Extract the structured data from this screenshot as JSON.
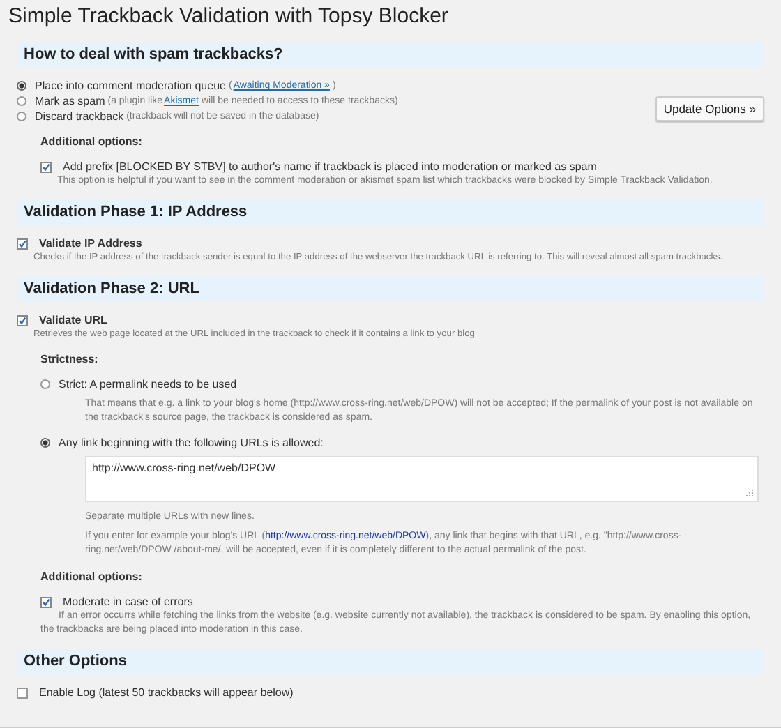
{
  "title": "Simple Trackback Validation with Topsy Blocker",
  "spam": {
    "heading": "How to deal with spam trackbacks?",
    "options": [
      {
        "label": "Place into comment moderation queue",
        "note_pre": "(",
        "link": "Awaiting Moderation »",
        "note_post": ")",
        "selected": true
      },
      {
        "label": "Mark as spam",
        "note_pre": "(a plugin like",
        "link": "Akismet",
        "note_post": "will be needed to access to these trackbacks)",
        "selected": false
      },
      {
        "label": "Discard trackback",
        "note_pre": "(trackback will not be saved in the database)",
        "selected": false
      }
    ],
    "button": "Update Options »",
    "additional": "Additional options:",
    "prefix": {
      "label": "Add prefix [BLOCKED BY STBV] to author's name if trackback is placed into moderation or marked as spam",
      "checked": true,
      "description": "This option is helpful if you want to see in the comment moderation or akismet spam list which trackbacks were blocked by Simple Trackback Validation."
    }
  },
  "phase1": {
    "heading": "Validation Phase 1: IP Address",
    "check": {
      "label": "Validate IP Address",
      "checked": true,
      "description": "Checks if the IP address of the trackback sender is equal to the IP address of the webserver the trackback URL is referring to. This will reveal almost all spam trackbacks."
    }
  },
  "phase2": {
    "heading": "Validation Phase 2: URL",
    "check": {
      "label": "Validate URL",
      "checked": true,
      "description": "Retrieves the web page located at the URL included in the trackback to check if it contains a link to your blog"
    },
    "strictness": "Strictness:",
    "options": [
      {
        "label": "Strict: A permalink needs to be used",
        "selected": false,
        "description": "That means that e.g. a link to your blog's home (http://www.cross-ring.net/web/DPOW) will not be accepted; If the permalink of your post is not available on the trackback's source page, the trackback is considered as spam."
      },
      {
        "label": "Any link beginning with the following URLs is allowed:",
        "selected": true
      }
    ],
    "urls": "http://www.cross-ring.net/web/DPOW",
    "hint": "Separate multiple URLs with new lines.",
    "example": {
      "pre": "If you enter for example your blog's URL (",
      "link": "http://www.cross-ring.net/web/DPOW",
      "post": "), any link that begins with that URL, e.g. \"http://www.cross-ring.net/web/DPOW /about-me/, will be accepted, even if it is completely different to the actual permalink of the post."
    },
    "additional": "Additional options:",
    "moderate": {
      "label": "Moderate in case of errors",
      "checked": true,
      "description": "If an error occurrs while fetching the links from the website (e.g. website currently not available), the trackback is considered to be spam. By enabling this option, the trackbacks are being placed into moderation in this case."
    }
  },
  "other": {
    "heading": "Other Options",
    "log": {
      "label": "Enable Log (latest 50 trackbacks will appear below)",
      "checked": false
    }
  }
}
